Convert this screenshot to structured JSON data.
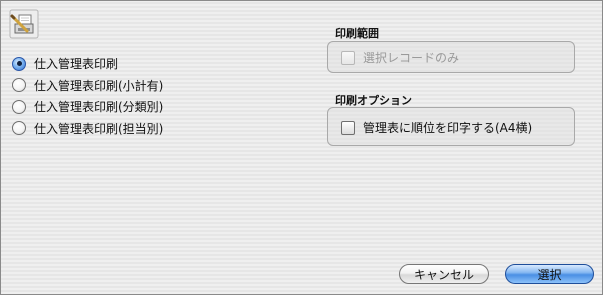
{
  "app_icon": "printer-icon",
  "print_type": {
    "options": [
      "仕入管理表印刷",
      "仕入管理表印刷(小計有)",
      "仕入管理表印刷(分類別)",
      "仕入管理表印刷(担当別)"
    ],
    "selected_index": 0
  },
  "print_range": {
    "title": "印刷範囲",
    "selected_records_only_label": "選択レコードのみ",
    "selected_records_only_checked": false,
    "selected_records_only_enabled": false
  },
  "print_options": {
    "title": "印刷オプション",
    "print_rank_label": "管理表に順位を印字する(A4横)",
    "print_rank_checked": false
  },
  "buttons": {
    "cancel_label": "キャンセル",
    "select_label": "選択"
  }
}
